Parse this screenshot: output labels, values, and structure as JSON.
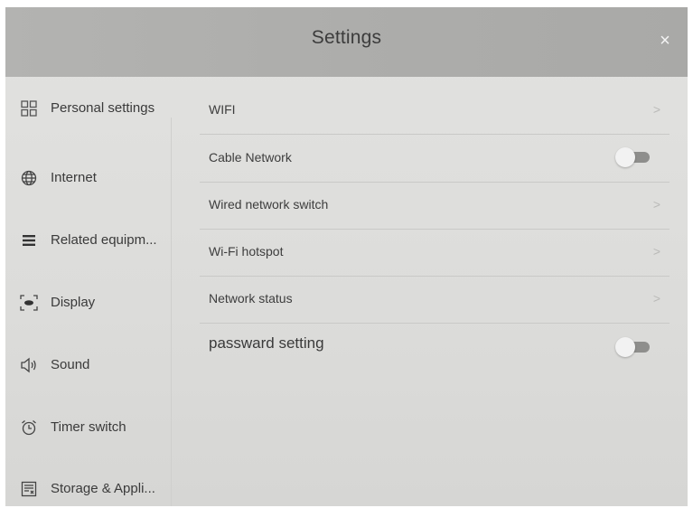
{
  "header": {
    "title": "Settings",
    "close_label": "×"
  },
  "sidebar": {
    "items": [
      {
        "label": "Personal settings",
        "icon": "grid-icon"
      },
      {
        "label": "Internet",
        "icon": "globe-icon"
      },
      {
        "label": "Related equipm...",
        "icon": "list-icon"
      },
      {
        "label": "Display",
        "icon": "display-icon"
      },
      {
        "label": "Sound",
        "icon": "speaker-icon"
      },
      {
        "label": "Timer switch",
        "icon": "alarm-clock-icon"
      },
      {
        "label": "Storage & Appli...",
        "icon": "storage-icon"
      }
    ]
  },
  "content": {
    "rows": [
      {
        "label": "WIFI",
        "control": "chevron"
      },
      {
        "label": "Cable Network",
        "control": "toggle",
        "state": "off"
      },
      {
        "label": "Wired network switch",
        "control": "chevron"
      },
      {
        "label": "Wi-Fi hotspot",
        "control": "chevron"
      },
      {
        "label": "Network status",
        "control": "chevron"
      },
      {
        "label": "passward setting",
        "control": "toggle",
        "state": "off"
      }
    ],
    "chevron_glyph": ">"
  },
  "colors": {
    "header_bg": "#adadab",
    "panel_bg": "#dcdcda",
    "toggle_track": "#8e8e8c",
    "toggle_knob": "#f2f2f2",
    "close_color": "#f4f4f4"
  }
}
